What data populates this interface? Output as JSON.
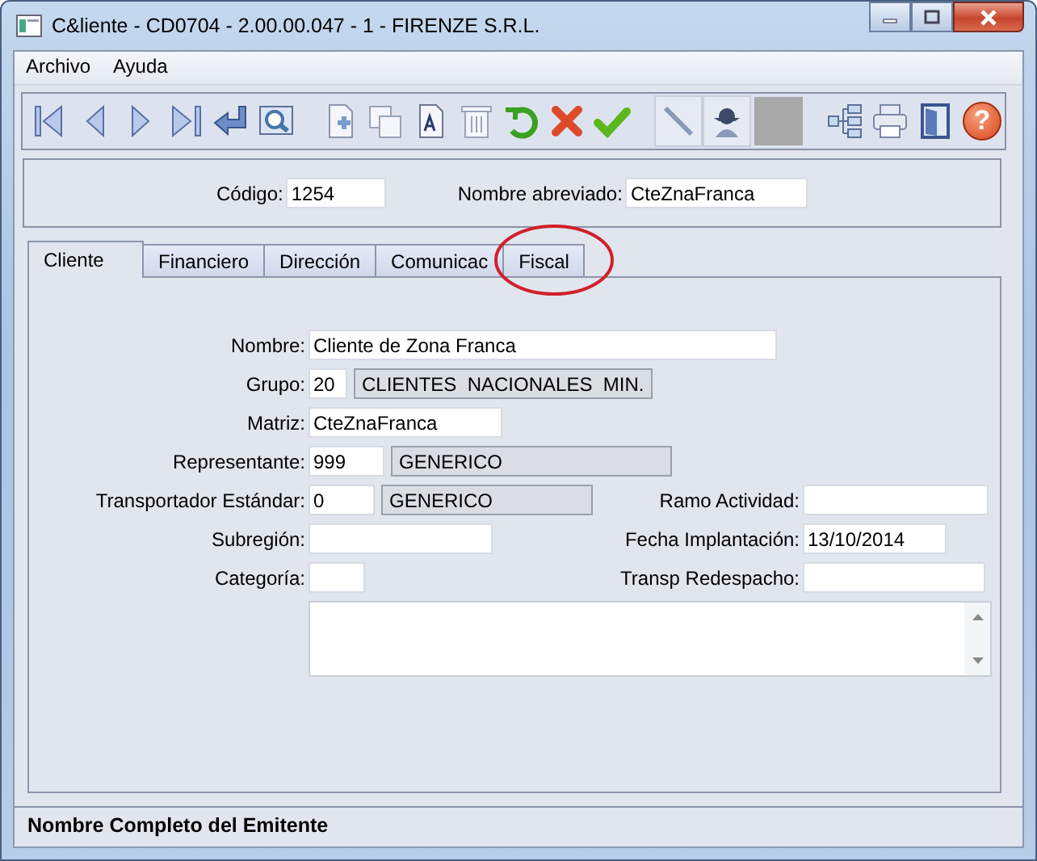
{
  "window": {
    "title": "C&liente - CD0704 - 2.00.00.047 - 1 - FIRENZE S.R.L."
  },
  "menu": [
    "Archivo",
    "Ayuda"
  ],
  "toolbar": [
    {
      "kind": "first"
    },
    {
      "kind": "prev"
    },
    {
      "kind": "next"
    },
    {
      "kind": "last"
    },
    {
      "kind": "enter"
    },
    {
      "kind": "preview"
    },
    {
      "kind": "gap"
    },
    {
      "kind": "new"
    },
    {
      "kind": "copy"
    },
    {
      "kind": "doc"
    },
    {
      "kind": "trash"
    },
    {
      "kind": "undo"
    },
    {
      "kind": "cancel"
    },
    {
      "kind": "accept"
    },
    {
      "kind": "gap"
    },
    {
      "kind": "pencil"
    },
    {
      "kind": "person"
    },
    {
      "kind": "blank"
    },
    {
      "kind": "gap"
    },
    {
      "kind": "tree"
    },
    {
      "kind": "print"
    },
    {
      "kind": "exit"
    },
    {
      "kind": "help",
      "glyph": "?"
    }
  ],
  "header": [
    {
      "label": "Código:",
      "value": "1254"
    },
    {
      "label": "Nombre abreviado:",
      "value": "CteZnaFranca"
    }
  ],
  "tabs": [
    {
      "label": "Cliente",
      "selected": true
    },
    {
      "label": "Financiero",
      "selected": false
    },
    {
      "label": "Dirección",
      "selected": false
    },
    {
      "label": "Comunicac",
      "selected": false
    },
    {
      "label": "Fiscal",
      "selected": false,
      "circled": true
    }
  ],
  "form_rows": [
    {
      "label": "Nombre:",
      "value": "Cliente de Zona Franca"
    },
    {
      "label": "Grupo:",
      "value": "20",
      "description": "CLIENTES  NACIONALES  MIN."
    },
    {
      "label": "Matriz:",
      "value": "CteZnaFranca"
    },
    {
      "label": "Representante:",
      "value": "999",
      "description": "GENERICO"
    },
    {
      "label": "Transportador Estándar:",
      "value": "0",
      "description": "GENERICO",
      "right": {
        "label": "Ramo Actividad:"
      }
    },
    {
      "label": "Subregión:",
      "right": {
        "label": "Fecha Implantación:",
        "value": "13/10/2014"
      }
    },
    {
      "label": "Categoría:",
      "right": {
        "label": "Transp Redespacho:"
      }
    }
  ],
  "status_bar": "Nombre Completo del Emitente"
}
